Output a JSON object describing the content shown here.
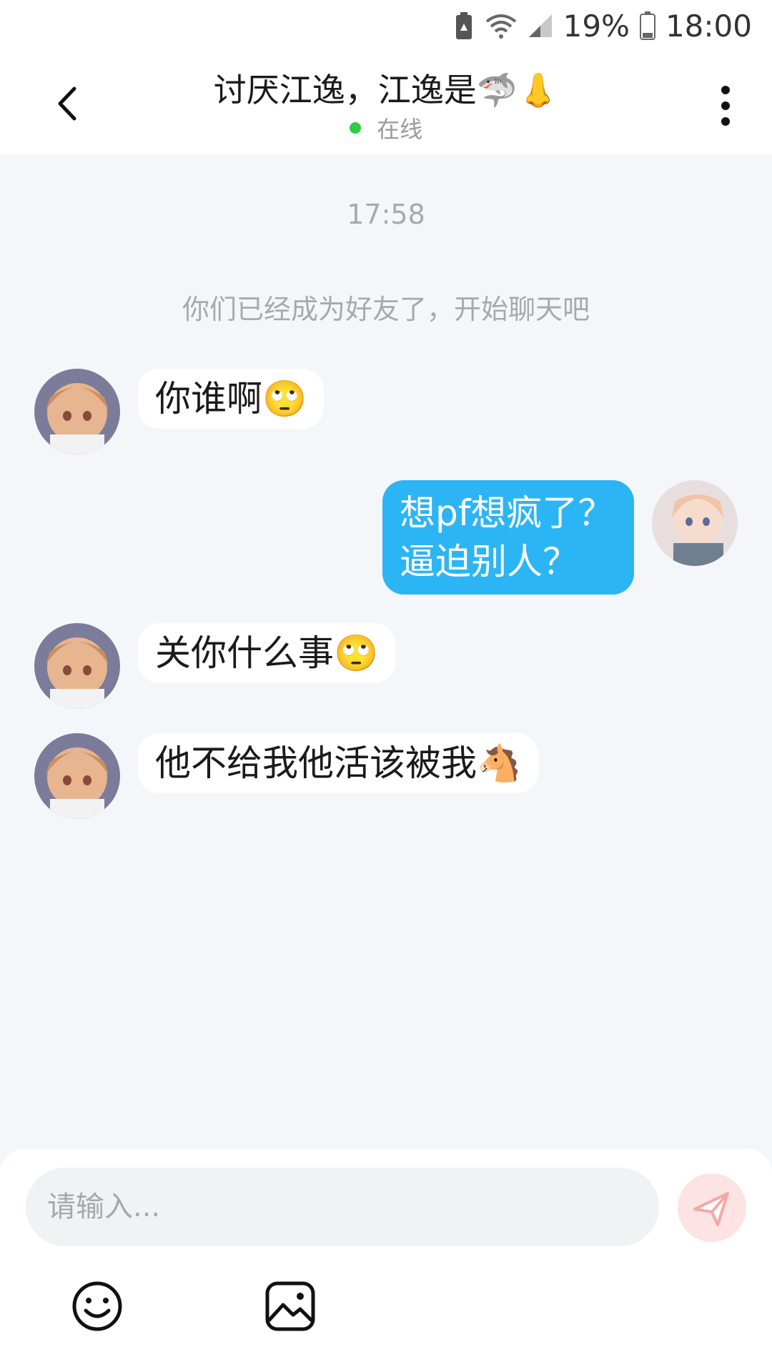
{
  "status_bar": {
    "battery_percent": "19%",
    "time": "18:00",
    "icons": [
      "battery-saver-icon",
      "wifi-icon",
      "signal-icon",
      "battery-icon"
    ]
  },
  "header": {
    "title": "讨厌江逸，江逸是🦈👃",
    "status": "在线",
    "back_icon": "chevron-left-icon",
    "more_icon": "more-vertical-icon"
  },
  "chat": {
    "timestamp": "17:58",
    "system_message": "你们已经成为好友了，开始聊天吧",
    "messages": [
      {
        "side": "left",
        "text": "你谁啊🙄"
      },
      {
        "side": "right",
        "text_line1": "想pf想疯了？",
        "text_line2": "逼迫别人？"
      },
      {
        "side": "left",
        "text": "关你什么事🙄"
      },
      {
        "side": "left",
        "text": "他不给我他活该被我🐴"
      }
    ]
  },
  "composer": {
    "placeholder": "请输入...",
    "send_icon": "send-icon",
    "emoji_icon": "emoji-icon",
    "image_icon": "image-icon"
  },
  "colors": {
    "accent_blue": "#2cb5f5",
    "online_green": "#2ecc40",
    "send_button_bg": "#fde3e3",
    "send_icon": "#f5a7a7"
  }
}
